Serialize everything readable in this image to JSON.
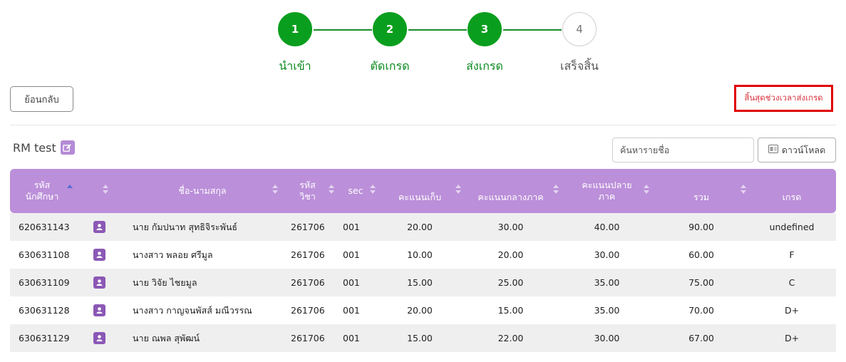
{
  "stepper": {
    "steps": [
      {
        "number": "1",
        "label": "นำเข้า",
        "state": "done"
      },
      {
        "number": "2",
        "label": "ตัดเกรด",
        "state": "done"
      },
      {
        "number": "3",
        "label": "ส่งเกรด",
        "state": "done"
      },
      {
        "number": "4",
        "label": "เสร็จสิ้น",
        "state": "todo"
      }
    ]
  },
  "toolbar": {
    "back_label": "ย้อนกลับ",
    "deadline_label": "สิ้นสุดช่วงเวลาส่งเกรด"
  },
  "course": {
    "title": "RM test"
  },
  "search": {
    "placeholder": "ค้นหารายชื่อ"
  },
  "download": {
    "label": "ดาวน์โหลด"
  },
  "table": {
    "headers": {
      "student_id": "รหัส\nนักศึกษา",
      "name": "ชื่อ-นามสกุล",
      "course_code": "รหัส\nวิชา",
      "sec": "sec",
      "collected": "คะแนนเก็บ",
      "midterm": "คะแนนกลางภาค",
      "final": "คะแนนปลาย\nภาค",
      "total": "รวม",
      "grade": "เกรด"
    },
    "rows": [
      {
        "student_id": "620631143",
        "name": "นาย กัมปนาท สุทธิจิระพันธ์",
        "course_code": "261706",
        "sec": "001",
        "collected": "20.00",
        "midterm": "30.00",
        "final": "40.00",
        "total": "90.00",
        "grade": "undefined"
      },
      {
        "student_id": "630631108",
        "name": "นางสาว พลอย ศรีมูล",
        "course_code": "261706",
        "sec": "001",
        "collected": "10.00",
        "midterm": "20.00",
        "final": "30.00",
        "total": "60.00",
        "grade": "F"
      },
      {
        "student_id": "630631109",
        "name": "นาย วิจัย ไชยมูล",
        "course_code": "261706",
        "sec": "001",
        "collected": "15.00",
        "midterm": "25.00",
        "final": "35.00",
        "total": "75.00",
        "grade": "C"
      },
      {
        "student_id": "630631128",
        "name": "นางสาว กาญจนพัสส์ มณีวรรณ",
        "course_code": "261706",
        "sec": "001",
        "collected": "20.00",
        "midterm": "15.00",
        "final": "35.00",
        "total": "70.00",
        "grade": "D+"
      },
      {
        "student_id": "630631129",
        "name": "นาย ณพล สุพัฒน์",
        "course_code": "261706",
        "sec": "001",
        "collected": "15.00",
        "midterm": "22.00",
        "final": "30.00",
        "total": "67.00",
        "grade": "D+"
      }
    ]
  },
  "colors": {
    "step_done": "#0a9e1e",
    "header_bg": "#bb8fd9",
    "person_icon": "#8b58b5",
    "deadline_border": "#e00000",
    "deadline_text": "#d9363e"
  },
  "icons": {
    "edit": "edit-icon",
    "person": "person-icon",
    "download": "download-icon"
  }
}
